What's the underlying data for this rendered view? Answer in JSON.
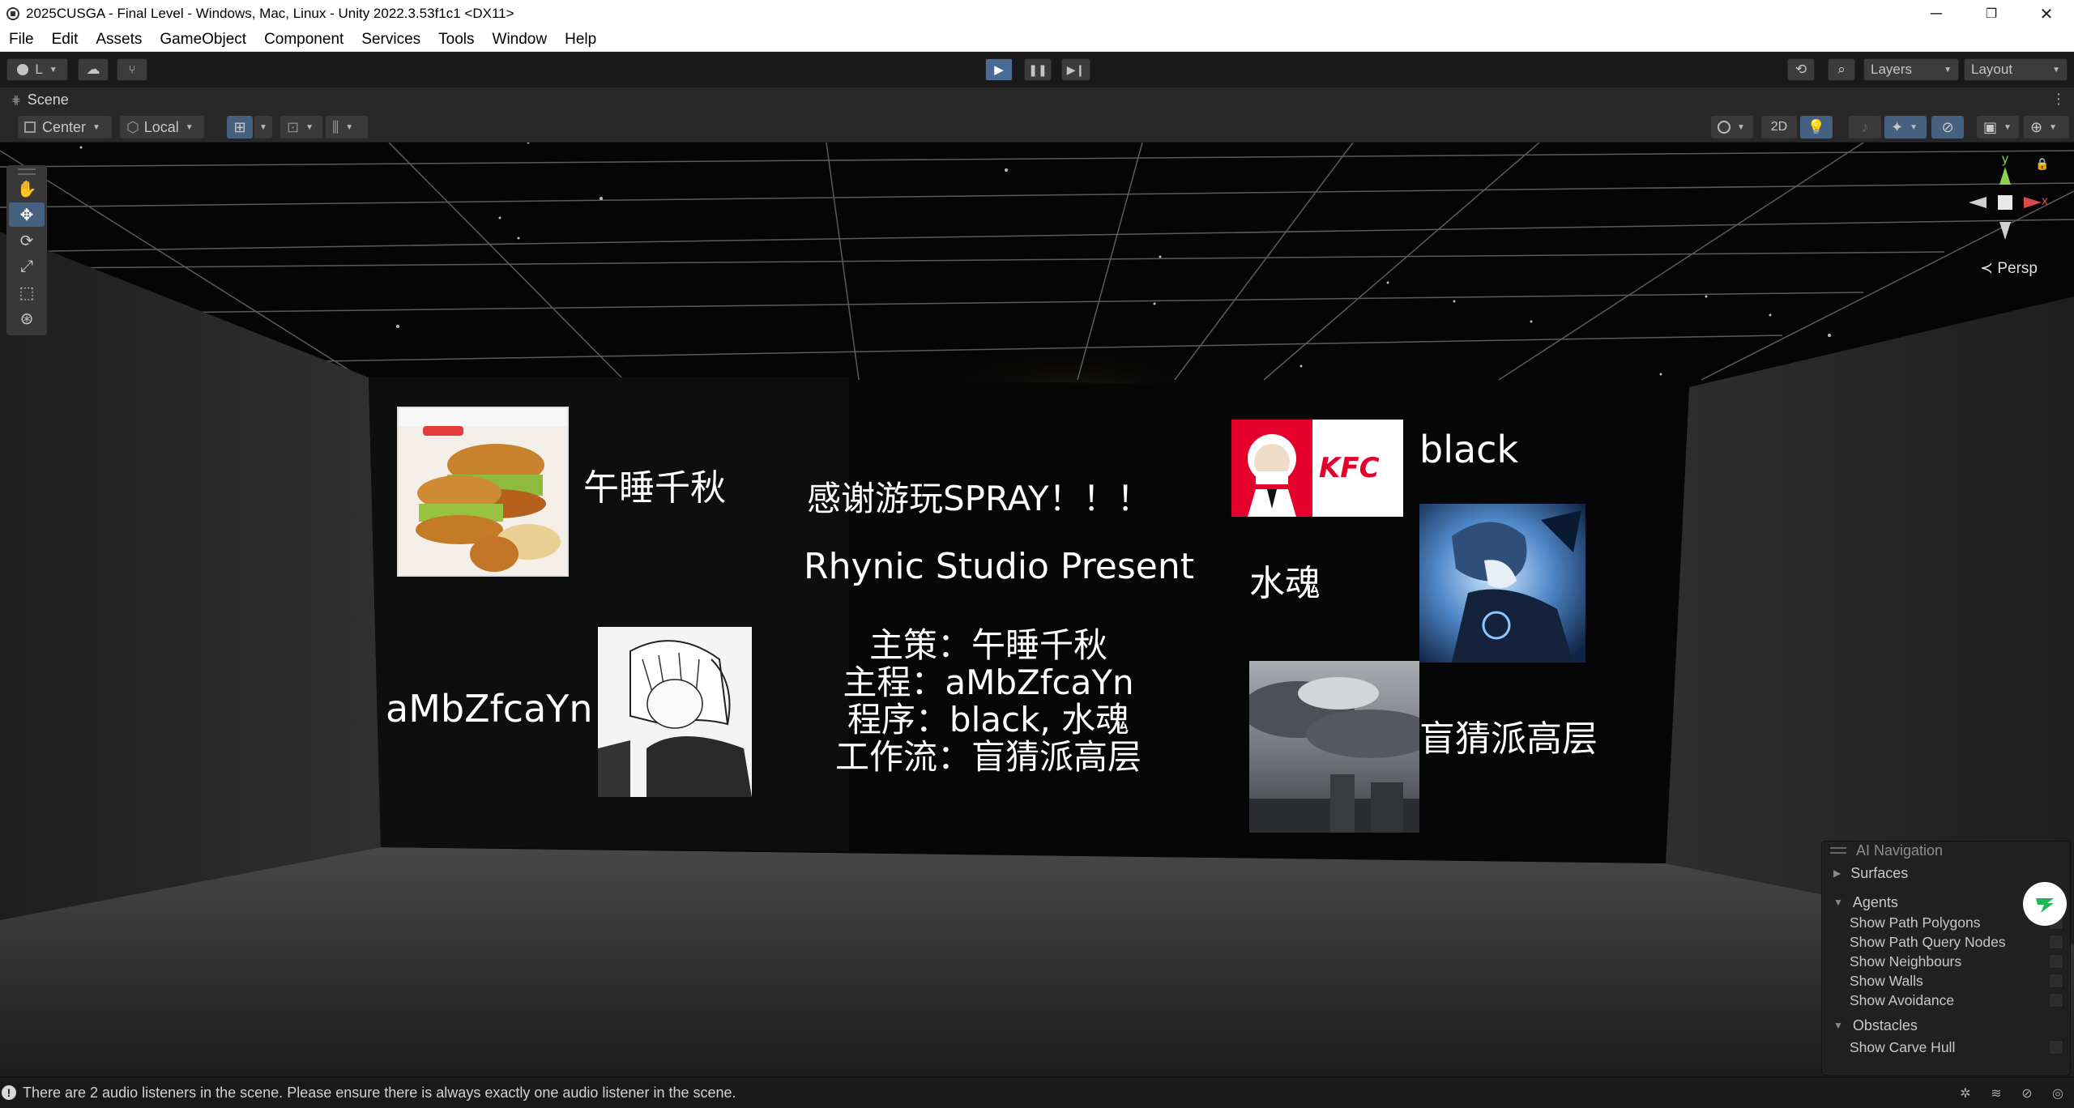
{
  "window": {
    "title": "2025CUSGA - Final Level - Windows, Mac, Linux - Unity 2022.3.53f1c1 <DX11>",
    "minimize": "─",
    "restore": "❐",
    "close": "✕"
  },
  "menu": [
    "File",
    "Edit",
    "Assets",
    "GameObject",
    "Component",
    "Services",
    "Tools",
    "Window",
    "Help"
  ],
  "toolbar": {
    "account_label": "L",
    "layers_label": "Layers",
    "layout_label": "Layout"
  },
  "scene": {
    "tab_label": "Scene",
    "pivot_mode": "Center",
    "pivot_rotation": "Local",
    "mode_2d_label": "2D",
    "persp_label": "Persp",
    "gizmo_axes": {
      "y": "y",
      "x": "x"
    }
  },
  "credits": {
    "thanks": "感谢游玩SPRAY！！！",
    "studio": "Rhynic Studio Present",
    "roles": [
      "主策：午睡千秋",
      "主程：aMbZfcaYn",
      "程序：black, 水魂",
      "工作流：盲猜派高层"
    ],
    "names": {
      "wushui": "午睡千秋",
      "amb": "aMbZfcaYn",
      "black": "black",
      "shuihun": "水魂",
      "mangcai": "盲猜派高层"
    },
    "kfc_logo_text": "KFC"
  },
  "ai_navigation": {
    "title": "AI Navigation",
    "surfaces": "Surfaces",
    "agents": "Agents",
    "agent_options": [
      "Show Path Polygons",
      "Show Path Query Nodes",
      "Show Neighbours",
      "Show Walls",
      "Show Avoidance"
    ],
    "obstacles": "Obstacles",
    "obstacle_options": [
      "Show Carve Hull"
    ]
  },
  "status": {
    "message": "There are 2 audio listeners in the scene. Please ensure there is always exactly one audio listener in the scene."
  },
  "colors": {
    "editor_bg": "#191919",
    "panel_bg": "#282828",
    "accent": "#46607f",
    "gizmo_x": "#d94a4a",
    "gizmo_y": "#8cd24a"
  }
}
